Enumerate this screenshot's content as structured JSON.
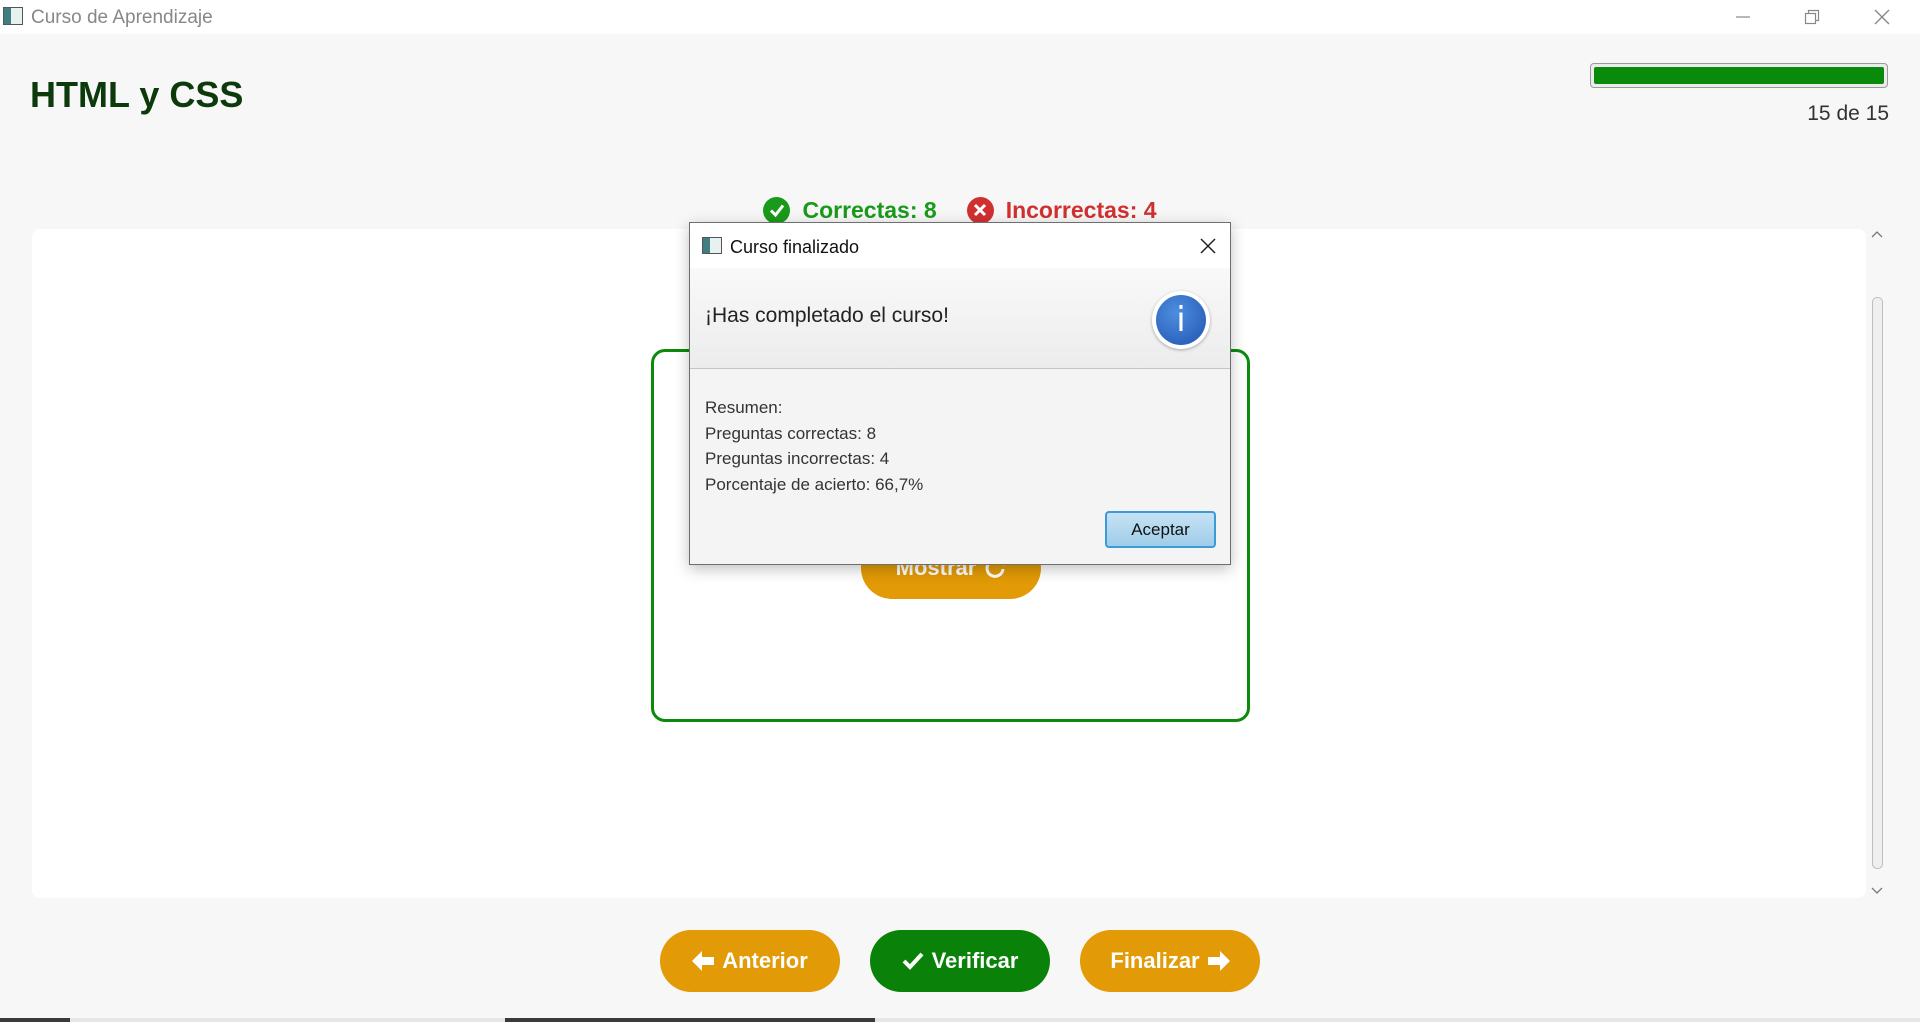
{
  "window": {
    "title": "Curso de Aprendizaje",
    "controls": [
      "minimize-icon",
      "restore-icon",
      "close-icon"
    ]
  },
  "header": {
    "course_title": "HTML y CSS",
    "progress": {
      "current": 15,
      "total": 15,
      "fraction": 1.0,
      "label": "15 de 15",
      "color": "#0a8a0a"
    }
  },
  "score": {
    "correct_label": "Correctas: 8",
    "incorrect_label": "Incorrectas: 4",
    "correct_color": "#1a9a1a",
    "incorrect_color": "#d03030"
  },
  "card": {
    "show_button_label": "Mostrar"
  },
  "navigation": {
    "prev_label": "Anterior",
    "verify_label": "Verificar",
    "finish_label": "Finalizar"
  },
  "dialog": {
    "title": "Curso finalizado",
    "header_text": "¡Has completado el curso!",
    "summary_lines": [
      "Resumen:",
      "Preguntas correctas: 8",
      "Preguntas incorrectas: 4",
      "Porcentaje de acierto: 66,7%"
    ],
    "ok_label": "Aceptar"
  }
}
